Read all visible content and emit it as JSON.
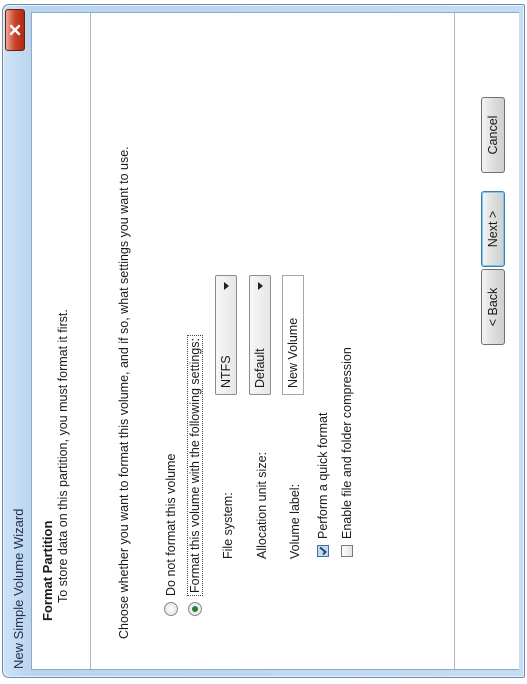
{
  "window": {
    "title": "New Simple Volume Wizard"
  },
  "header": {
    "title": "Format Partition",
    "subtitle": "To store data on this partition, you must format it first."
  },
  "body": {
    "instruction": "Choose whether you want to format this volume, and if so, what settings you want to use.",
    "options": {
      "no_format": "Do not format this volume",
      "format": "Format this volume with the following settings:",
      "selected": "format"
    },
    "fields": {
      "file_system": {
        "label": "File system:",
        "value": "NTFS"
      },
      "allocation": {
        "label": "Allocation unit size:",
        "value": "Default"
      },
      "volume_label": {
        "label": "Volume label:",
        "value": "New Volume"
      }
    },
    "checkboxes": {
      "quick_format": {
        "label": "Perform a quick format",
        "checked": true
      },
      "compression": {
        "label": "Enable file and folder compression",
        "checked": false
      }
    }
  },
  "footer": {
    "back": "< Back",
    "next": "Next >",
    "cancel": "Cancel"
  },
  "icons": {
    "close": "close-icon",
    "combo_arrow": "chevron-down-icon",
    "check": "checkmark-icon"
  },
  "colors": {
    "close_button": "#c8432a",
    "frame": "#c6dcf2",
    "default_button_border": "#3c7fb1"
  }
}
